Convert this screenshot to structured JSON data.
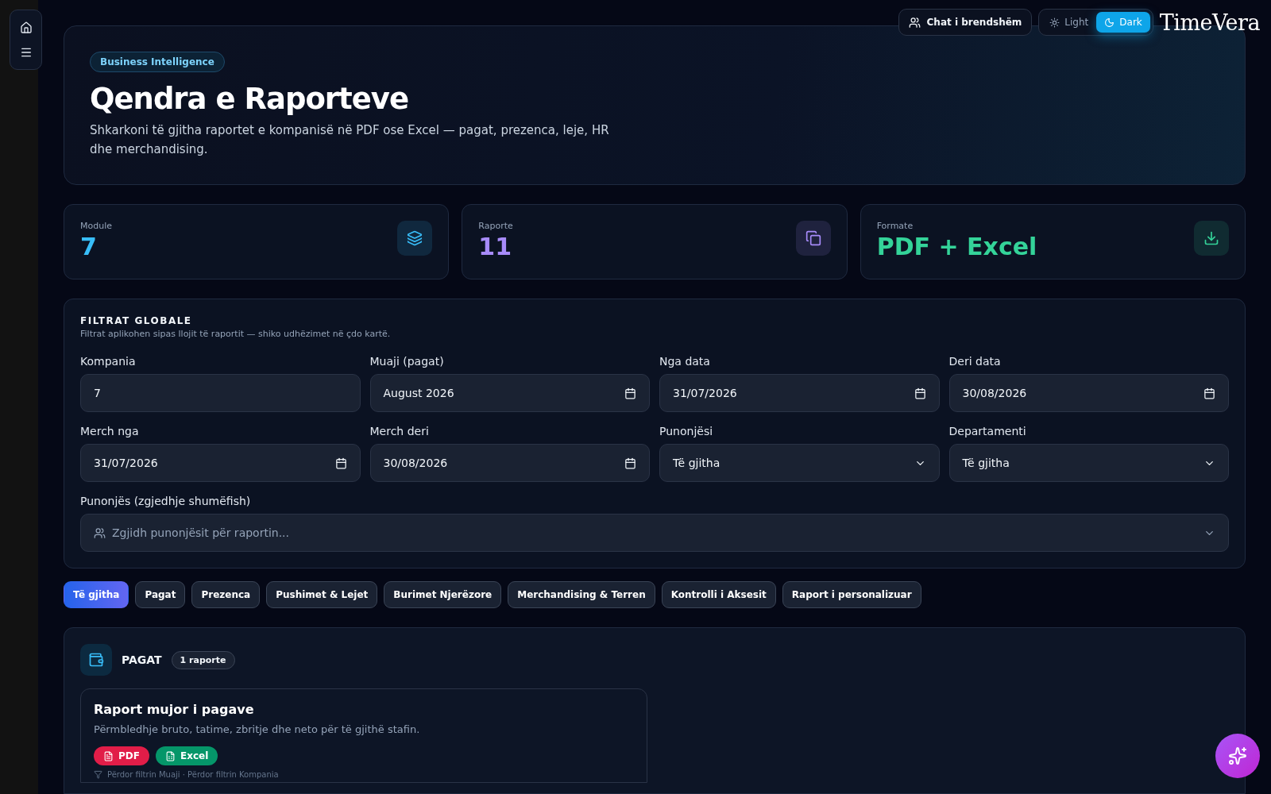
{
  "topbar": {
    "chat_label": "Chat i brendshëm",
    "theme_options": [
      {
        "label": "Light",
        "kind": "light",
        "selected": false
      },
      {
        "label": "Dark",
        "kind": "dark",
        "selected": true
      }
    ],
    "logo": "TimeVera"
  },
  "hero": {
    "badge": "Business Intelligence",
    "title": "Qendra e Raporteve",
    "subtitle": "Shkarkoni të gjitha raportet e kompanisë në PDF ose Excel — pagat, prezenca, leje, HR dhe merchandising."
  },
  "stats": [
    {
      "label": "Module",
      "value": "7",
      "kind": "layers",
      "color": "#38bdf8"
    },
    {
      "label": "Raporte",
      "value": "11",
      "kind": "copy",
      "color": "#a78bfa"
    },
    {
      "label": "Formate",
      "value": "PDF + Excel",
      "kind": "download",
      "color": "#34d399"
    }
  ],
  "filters": {
    "title": "FILTRAT GLOBALE",
    "subtitle": "Filtrat aplikohen sipas llojit të raportit — shiko udhëzimet në çdo kartë.",
    "fields": [
      {
        "label": "Kompania",
        "value": "7",
        "kind": "text"
      },
      {
        "label": "Muaji (pagat)",
        "value": "August 2026",
        "kind": "date"
      },
      {
        "label": "Nga data",
        "value": "31/07/2026",
        "kind": "date"
      },
      {
        "label": "Deri data",
        "value": "30/08/2026",
        "kind": "date"
      },
      {
        "label": "Merch nga",
        "value": "31/07/2026",
        "kind": "date"
      },
      {
        "label": "Merch deri",
        "value": "30/08/2026",
        "kind": "date"
      },
      {
        "label": "Punonjësi",
        "value": "Të gjitha",
        "kind": "select"
      },
      {
        "label": "Departamenti",
        "value": "Të gjitha",
        "kind": "select"
      }
    ],
    "multi": {
      "label": "Punonjës (zgjedhje shumëfish)",
      "placeholder": "Zgjidh punonjësit për raportin..."
    }
  },
  "tabs": [
    {
      "label": "Të gjitha",
      "selected": true
    },
    {
      "label": "Pagat",
      "selected": false
    },
    {
      "label": "Prezenca",
      "selected": false
    },
    {
      "label": "Pushimet & Lejet",
      "selected": false
    },
    {
      "label": "Burimet Njerëzore",
      "selected": false
    },
    {
      "label": "Merchandising & Terren",
      "selected": false
    },
    {
      "label": "Kontrolli i Aksesit",
      "selected": false
    },
    {
      "label": "Raport i personalizuar",
      "selected": false
    }
  ],
  "section": {
    "title": "PAGAT",
    "count": "1 raporte",
    "reports": [
      {
        "title": "Raport mujor i pagave",
        "description": "Përmbledhje bruto, tatime, zbritje dhe neto për të gjithë stafin.",
        "buttons": [
          {
            "label": "PDF",
            "kind": "pdf"
          },
          {
            "label": "Excel",
            "kind": "excel"
          }
        ],
        "note": "Përdor filtrin Muaji · Përdor filtrin Kompania"
      }
    ]
  }
}
